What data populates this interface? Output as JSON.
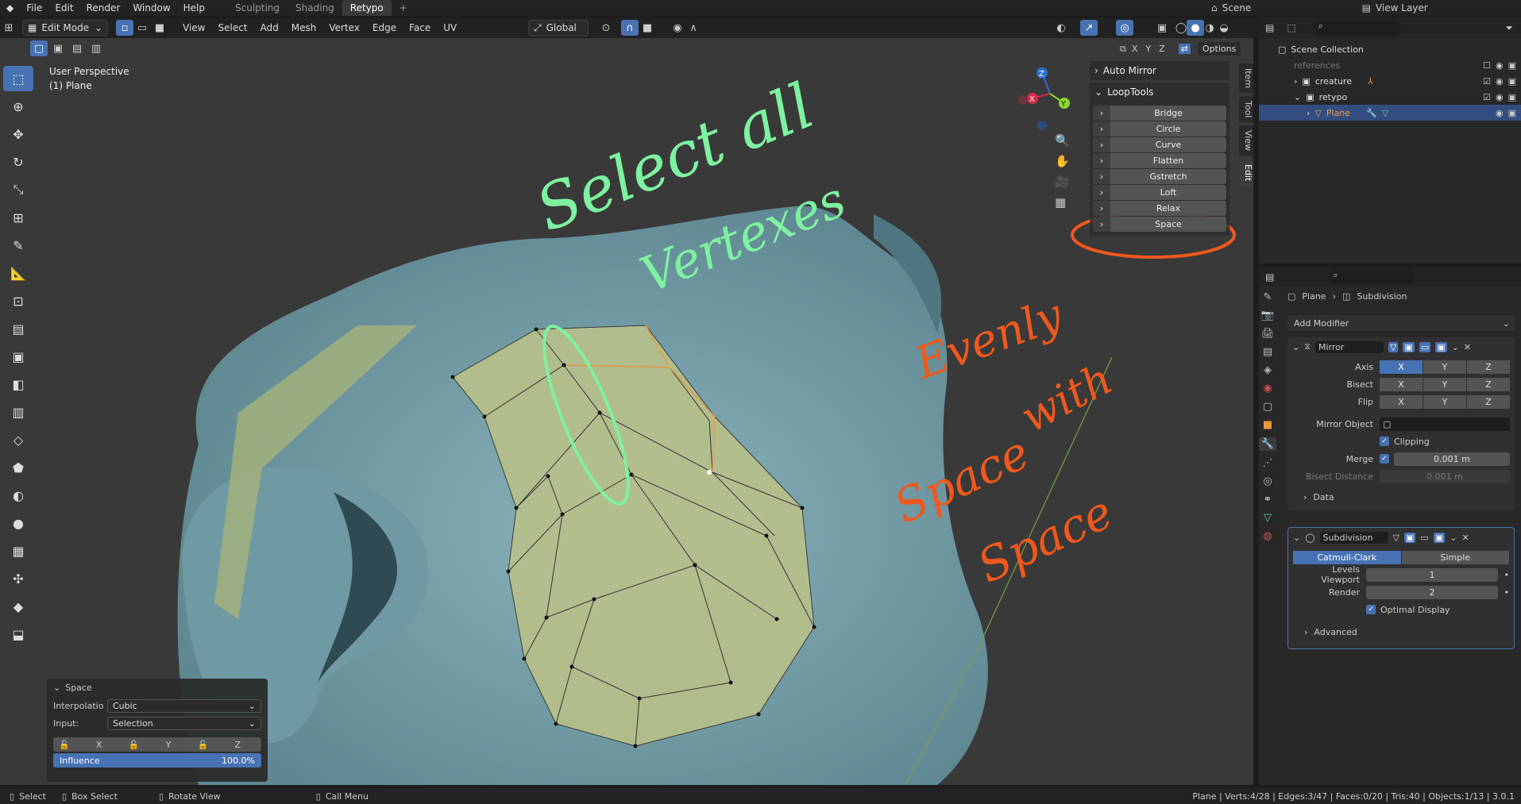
{
  "topbar": {
    "menus": [
      "File",
      "Edit",
      "Render",
      "Window",
      "Help"
    ],
    "tabs": [
      "Sculpting",
      "Shading",
      "Retypo"
    ],
    "add_tab": "+",
    "scene": "Scene",
    "view_layer": "View Layer"
  },
  "vp_header": {
    "mode": "Edit Mode",
    "menus": [
      "View",
      "Select",
      "Add",
      "Mesh",
      "Vertex",
      "Edge",
      "Face",
      "UV"
    ],
    "orientation": "Global",
    "options": "Options",
    "axes": [
      "X",
      "Y",
      "Z"
    ]
  },
  "viewport": {
    "perspective": "User Perspective",
    "object": "(1) Plane"
  },
  "npanel": {
    "auto_mirror": "Auto Mirror",
    "looptools": "LoopTools",
    "buttons": [
      "Bridge",
      "Circle",
      "Curve",
      "Flatten",
      "Gstretch",
      "Loft",
      "Relax",
      "Space"
    ],
    "tabs": [
      "Item",
      "Tool",
      "View",
      "Edit"
    ]
  },
  "annotations": {
    "green1": "Select all",
    "green2": "Vertexes",
    "orange1": "Evenly",
    "orange2": "with",
    "orange3": "Space",
    "orange4": "Space"
  },
  "op_panel": {
    "title": "Space",
    "interp_label": "Interpolatio...",
    "interp_value": "Cubic",
    "input_label": "Input:",
    "input_value": "Selection",
    "axes": [
      "X",
      "Y",
      "Z"
    ],
    "influence_label": "Influence",
    "influence_value": "100.0%"
  },
  "outliner": {
    "title": "Scene Collection",
    "rows": [
      "references",
      "creature",
      "retypo",
      "Plane"
    ]
  },
  "props": {
    "breadcrumb_obj": "Plane",
    "breadcrumb_mod": "Subdivision",
    "add_modifier": "Add Modifier",
    "mirror": {
      "name": "Mirror",
      "axis_label": "Axis",
      "bisect_label": "Bisect",
      "flip_label": "Flip",
      "axes": [
        "X",
        "Y",
        "Z"
      ],
      "mirror_obj_label": "Mirror Object",
      "clipping": "Clipping",
      "merge_label": "Merge",
      "merge_value": "0.001 m",
      "bisect_dist_label": "Bisect Distance",
      "bisect_dist_value": "0.001 m",
      "data": "Data"
    },
    "subdiv": {
      "name": "Subdivision",
      "catmull": "Catmull-Clark",
      "simple": "Simple",
      "levels_label": "Levels Viewport",
      "levels_value": "1",
      "render_label": "Render",
      "render_value": "2",
      "optimal": "Optimal Display",
      "advanced": "Advanced"
    }
  },
  "statusbar": {
    "select": "Select",
    "box_select": "Box Select",
    "rotate": "Rotate View",
    "call_menu": "Call Menu",
    "stats": "Plane | Verts:4/28 | Edges:3/47 | Faces:0/20 | Tris:40 | Objects:1/13 | 3.0.1"
  },
  "colors": {
    "accent": "#4772b3",
    "mesh_blue": "#7fa3ad",
    "retopo": "#b7c08a",
    "green_ann": "#7df2a0",
    "orange_ann": "#f0581c"
  }
}
